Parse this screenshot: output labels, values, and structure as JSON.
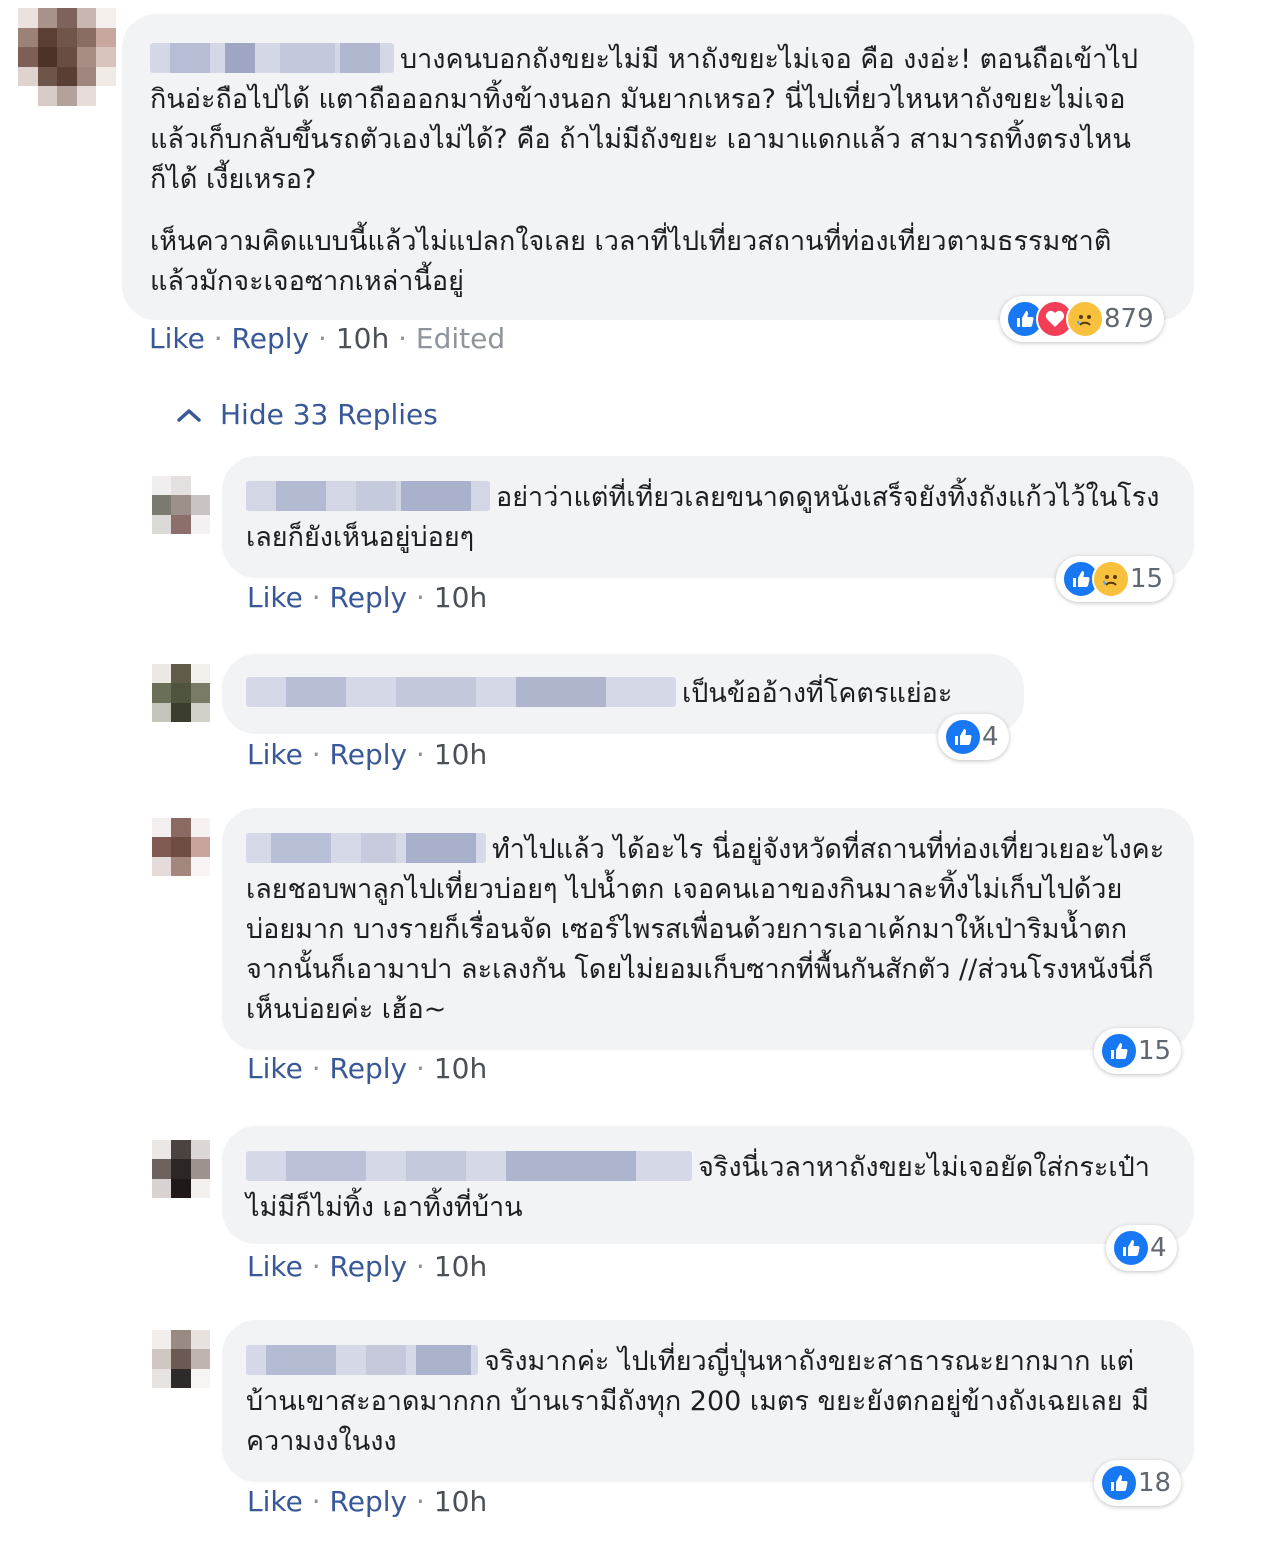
{
  "main_comment": {
    "author_blurred": true,
    "text_p1": "บางคนบอกถังขยะไม่มี หาถังขยะไม่เจอ คือ งงอ่ะ! ตอนถือเข้าไปกินอ่ะถือไปได้ แตาถือออกมาทิ้งข้างนอก มันยากเหรอ? นี่ไปเที่ยวไหนหาถังขยะไม่เจอ แล้วเก็บกลับขึ้นรถตัวเองไม่ได้? คือ ถ้าไม่มีถังขยะ เอามาแดกแล้ว สามารถทิ้งตรงไหนก็ได้ เงี้ยเหรอ?",
    "text_p2": "เห็นความคิดแบบนี้แล้วไม่แปลกใจเลย เวลาที่ไปเที่ยวสถานที่ท่องเที่ยวตามธรรมชาติ แล้วมักจะเจอซากเหล่านี้อยู่",
    "reaction_count": "879",
    "reactions": [
      "like-icon",
      "love-icon",
      "sad-icon"
    ],
    "like_label": "Like",
    "reply_label": "Reply",
    "time": "10h",
    "edited": "Edited"
  },
  "hide_replies_label": "Hide 33 Replies",
  "replies": [
    {
      "text": "อย่าว่าแต่ที่เที่ยวเลยขนาดดูหนังเสร็จยังทิ้งถังแก้วไว้ในโรงเลยก็ยังเห็นอยู่บ่อยๆ",
      "reaction_count": "15",
      "reactions": [
        "like-icon",
        "sad-icon"
      ],
      "like_label": "Like",
      "reply_label": "Reply",
      "time": "10h"
    },
    {
      "text": "เป็นข้ออ้างที่โคตรแย่อะ",
      "reaction_count": "4",
      "reactions": [
        "like-icon"
      ],
      "like_label": "Like",
      "reply_label": "Reply",
      "time": "10h"
    },
    {
      "text": "ทำไปแล้ว ได้อะไร นี่อยู่จังหวัดที่สถานที่ท่องเที่ยวเยอะไงคะ เลยชอบพาลูกไปเที่ยวบ่อยๆ ไปน้ำตก เจอคนเอาของกินมาละทิ้งไม่เก็บไปด้วยบ่อยมาก บางรายก็เรื่อนจัด เซอร์ไพรสเพื่อนด้วยการเอาเค้กมาให้เป่าริมน้ำตก จากนั้นก็เอามาปา ละเลงกัน โดยไม่ยอมเก็บซากที่พื้นกันสักตัว //ส่วนโรงหนังนี่ก็เห็นบ่อยค่ะ เฮ้อ~",
      "reaction_count": "15",
      "reactions": [
        "like-icon"
      ],
      "like_label": "Like",
      "reply_label": "Reply",
      "time": "10h"
    },
    {
      "text": "จริงนี่เวลาหาถังขยะไม่เจอยัดใส่กระเป๋าไม่มีก็ไม่ทิ้ง เอาทิ้งที่บ้าน",
      "reaction_count": "4",
      "reactions": [
        "like-icon"
      ],
      "like_label": "Like",
      "reply_label": "Reply",
      "time": "10h"
    },
    {
      "text": "จริงมากค่ะ ไปเที่ยวญี่ปุ่นหาถังขยะสาธารณะยากมาก แต่บ้านเขาสะอาดมากกก บ้านเรามีถังทุก 200 เมตร ขยะยังตกอยู่ข้างถังเฉยเลย มีความงงในงง",
      "reaction_count": "18",
      "reactions": [
        "like-icon"
      ],
      "like_label": "Like",
      "reply_label": "Reply",
      "time": "10h"
    }
  ],
  "colors": {
    "bubble": "#f2f3f5",
    "link": "#385898",
    "like": "#1877f2",
    "love": "#f33e58",
    "sad": "#f7c13e"
  }
}
